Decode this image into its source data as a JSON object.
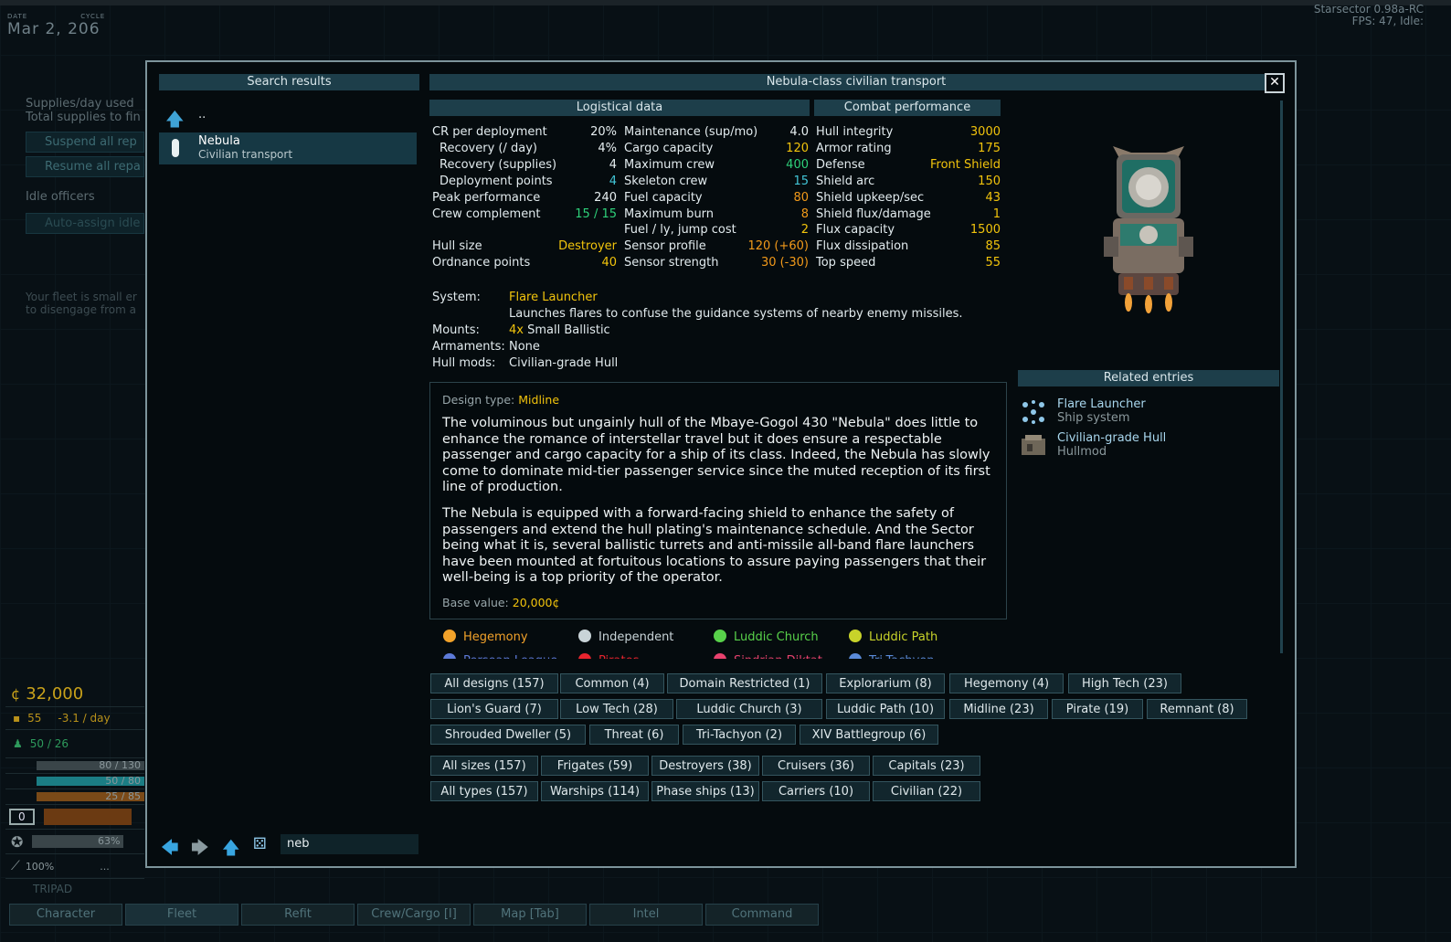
{
  "background": {
    "date_label": "DATE",
    "cycle_label": "CYCLE",
    "date": "Mar  2,  206",
    "version": "Starsector 0.98a-RC",
    "fps": "FPS:  47, Idle:",
    "left_panel": {
      "supplies_used": "Supplies/day used",
      "total_supplies": "Total supplies to fin",
      "suspend": "Suspend all rep",
      "resume": "Resume all repa",
      "idle_officers": "Idle officers",
      "auto_assign": "Auto-assign idle",
      "fleet_note_1": "Your fleet is small er",
      "fleet_note_2": "to disengage from a"
    },
    "resources": {
      "credits": "32,000",
      "supplies": "55",
      "supplies_rate": "-3.1 / day",
      "crew": "50 / 26",
      "cargo": "80 / 130",
      "fuel": "50 / 80",
      "fuel2": "25 / 85",
      "zero": "0",
      "cr": "63%",
      "pct": "100%",
      "dots": "...",
      "ship_name": "TRIPAD"
    },
    "bottom_tabs": [
      "Character",
      "Fleet",
      "Refit",
      "Crew/Cargo [I]",
      "Map [Tab]",
      "Intel",
      "Command"
    ]
  },
  "dialog": {
    "search_header": "Search results",
    "up_label": "..",
    "result": {
      "name": "Nebula",
      "sub": "Civilian transport"
    },
    "title": "Nebula-class civilian transport",
    "close": "✕",
    "logistical_header": "Logistical data",
    "combat_header": "Combat performance",
    "col1": [
      {
        "label": "CR per deployment",
        "value": "20%",
        "color": "w"
      },
      {
        "label": "Recovery (/ day)",
        "value": "4%",
        "color": "w"
      },
      {
        "label": "Recovery (supplies)",
        "value": "4",
        "color": "w"
      },
      {
        "label": "Deployment points",
        "value": "4",
        "color": "c"
      },
      {
        "label": "Peak performance",
        "value": "240",
        "color": "w"
      },
      {
        "label": "Crew complement",
        "value": "15 / 15",
        "color": "g"
      },
      {
        "label": "",
        "value": "",
        "color": "w"
      },
      {
        "label": "Hull size",
        "value": "Destroyer",
        "color": "y"
      },
      {
        "label": "Ordnance points",
        "value": "40",
        "color": "y"
      }
    ],
    "col2": [
      {
        "label": "Maintenance (sup/mo)",
        "value": "4.0",
        "color": "w"
      },
      {
        "label": "Cargo capacity",
        "value": "120",
        "color": "y"
      },
      {
        "label": "Maximum crew",
        "value": "400",
        "color": "g"
      },
      {
        "label": "Skeleton crew",
        "value": "15",
        "color": "c"
      },
      {
        "label": "Fuel capacity",
        "value": "80",
        "color": "o"
      },
      {
        "label": "Maximum burn",
        "value": "8",
        "color": "o"
      },
      {
        "label": "Fuel / ly, jump cost",
        "value": "2",
        "color": "y"
      },
      {
        "label": "Sensor profile",
        "value": "120 (+60)",
        "color": "o"
      },
      {
        "label": "Sensor strength",
        "value": "30 (-30)",
        "color": "o"
      }
    ],
    "col3": [
      {
        "label": "Hull integrity",
        "value": "3000",
        "color": "y"
      },
      {
        "label": "Armor rating",
        "value": "175",
        "color": "y"
      },
      {
        "label": "Defense",
        "value": "Front Shield",
        "color": "y"
      },
      {
        "label": "Shield arc",
        "value": "150",
        "color": "y"
      },
      {
        "label": "Shield upkeep/sec",
        "value": "43",
        "color": "y"
      },
      {
        "label": "Shield flux/damage",
        "value": "1",
        "color": "y"
      },
      {
        "label": "Flux capacity",
        "value": "1500",
        "color": "y"
      },
      {
        "label": "Flux dissipation",
        "value": "85",
        "color": "y"
      },
      {
        "label": "Top speed",
        "value": "55",
        "color": "y"
      }
    ],
    "system_label": "System:",
    "system_value": "Flare Launcher",
    "system_desc": "Launches flares to confuse the guidance systems of nearby enemy missiles.",
    "mounts_label": "Mounts:",
    "mounts_count": "4x",
    "mounts_value": "Small Ballistic",
    "armaments_label": "Armaments:",
    "armaments_value": "None",
    "hullmods_label": "Hull mods:",
    "hullmods_value": "Civilian-grade Hull",
    "design_label": "Design type:",
    "design_value": "Midline",
    "desc_p1": "The voluminous but ungainly hull of the Mbaye-Gogol 430 \"Nebula\" does little to enhance the romance of interstellar travel but it does ensure a respectable passenger and cargo capacity for a ship of its class. Indeed, the Nebula has slowly come to dominate mid-tier passenger service since the muted reception of its first line of production.",
    "desc_p2": "The Nebula is equipped with a forward-facing shield to enhance the safety of passengers and extend the hull plating's maintenance schedule. And the Sector being what it is, several ballistic turrets and anti-missile all-band flare launchers have been mounted at fortuitous locations to assure paying passengers that their well-being is a top priority of the operator.",
    "base_value_label": "Base value:",
    "base_value": "20,000¢",
    "related_header": "Related entries",
    "related": [
      {
        "name": "Flare Launcher",
        "type": "Ship system"
      },
      {
        "name": "Civilian-grade Hull",
        "type": "Hullmod"
      }
    ],
    "factions": [
      {
        "name": "Hegemony",
        "color": "#f2a22a"
      },
      {
        "name": "Independent",
        "color": "#c9d4d8"
      },
      {
        "name": "Luddic Church",
        "color": "#58d14a"
      },
      {
        "name": "Luddic Path",
        "color": "#c8d32a"
      }
    ],
    "factions_cut": [
      {
        "name": "Persean League",
        "color": "#5d7ad8"
      },
      {
        "name": "Pirates",
        "color": "#e8242e"
      },
      {
        "name": "Sindrian Diktat",
        "color": "#e8426e"
      },
      {
        "name": "Tri-Tachyon",
        "color": "#5a8ad8"
      }
    ],
    "filter_row1": [
      "All designs (157)",
      "Common (4)",
      "Domain Restricted (1)",
      "Explorarium (8)",
      "Hegemony (4)",
      "High Tech (23)"
    ],
    "filter_row2": [
      "Lion's Guard (7)",
      "Low Tech (28)",
      "Luddic Church (3)",
      "Luddic Path (10)",
      "Midline (23)",
      "Pirate (19)",
      "Remnant (8)"
    ],
    "filter_row3": [
      "Shrouded Dweller (5)",
      "Threat (6)",
      "Tri-Tachyon (2)",
      "XIV Battlegroup (6)"
    ],
    "size_row": [
      "All sizes (157)",
      "Frigates (59)",
      "Destroyers (38)",
      "Cruisers (36)",
      "Capitals (23)"
    ],
    "type_row": [
      "All types (157)",
      "Warships (114)",
      "Phase ships (13)",
      "Carriers (10)",
      "Civilian (22)"
    ],
    "search_text": "neb"
  }
}
